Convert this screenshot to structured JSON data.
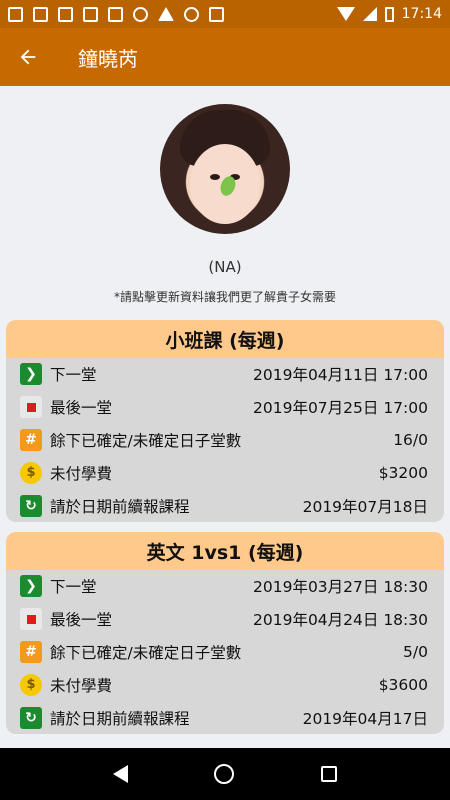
{
  "status_bar": {
    "time": "17:14",
    "left_icons": [
      "notes-icon",
      "app-icon",
      "list-icon",
      "image-icon",
      "save-icon",
      "settings-icon",
      "drive-icon",
      "circle-icon",
      "check-icon"
    ]
  },
  "app_bar": {
    "title": "鐘曉芮",
    "back_icon": "arrow-left-icon"
  },
  "profile": {
    "name": "(NA)",
    "hint": "*請點擊更新資料讓我們更了解貴子女需要"
  },
  "courses": [
    {
      "title": "小班課 (每週)",
      "rows": [
        {
          "icon": "next-icon",
          "label": "下一堂",
          "value": "2019年04月11日 17:00"
        },
        {
          "icon": "stop-icon",
          "label": "最後一堂",
          "value": "2019年07月25日 17:00"
        },
        {
          "icon": "hash-icon",
          "label": "餘下已確定/未確定日子堂數",
          "value": "16/0"
        },
        {
          "icon": "dollar-icon",
          "label": "未付學費",
          "value": "$3200"
        },
        {
          "icon": "renew-icon",
          "label": "請於日期前續報課程",
          "value": "2019年07月18日"
        }
      ]
    },
    {
      "title": "英文 1vs1 (每週)",
      "rows": [
        {
          "icon": "next-icon",
          "label": "下一堂",
          "value": "2019年03月27日 18:30"
        },
        {
          "icon": "stop-icon",
          "label": "最後一堂",
          "value": "2019年04月24日 18:30"
        },
        {
          "icon": "hash-icon",
          "label": "餘下已確定/未確定日子堂數",
          "value": "5/0"
        },
        {
          "icon": "dollar-icon",
          "label": "未付學費",
          "value": "$3600"
        },
        {
          "icon": "renew-icon",
          "label": "請於日期前續報課程",
          "value": "2019年04月17日"
        }
      ]
    }
  ],
  "colors": {
    "status_bar": "#b86200",
    "app_bar": "#c66a00",
    "card_header": "#ffc98c",
    "card_body": "#d7d7d7"
  }
}
